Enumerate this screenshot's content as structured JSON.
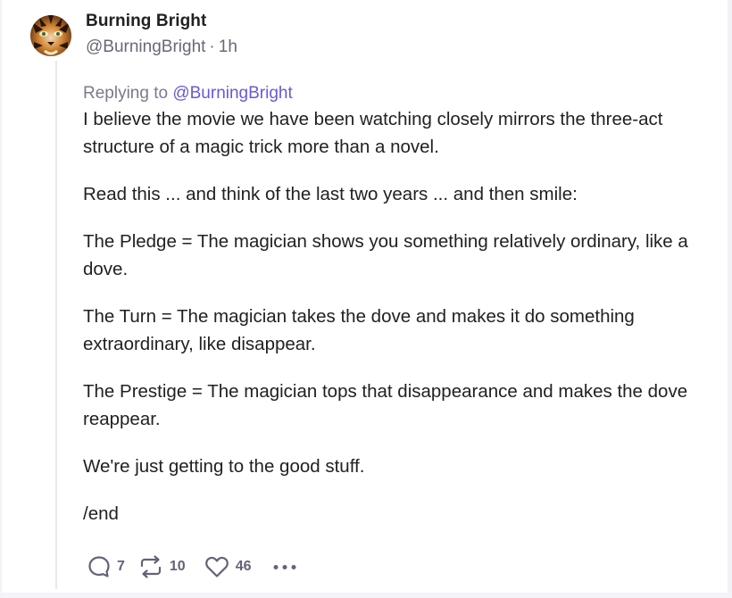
{
  "post": {
    "author": {
      "display_name": "Burning Bright",
      "handle": "@BurningBright",
      "timestamp": "1h",
      "separator": "·"
    },
    "reply": {
      "prefix": "Replying to",
      "handle": "@BurningBright"
    },
    "paragraphs": [
      "I believe the movie we have been watching closely mirrors the three-act structure of a magic trick more than a novel.",
      "Read this ... and think of the last two years ... and then smile:",
      "The Pledge = The magician shows you something relatively ordinary, like a dove.",
      "The Turn = The magician takes the dove and makes it do something extraordinary, like disappear.",
      "The Prestige = The magician tops that disappearance and makes the dove reappear.",
      "We're just getting to the good stuff.",
      "/end"
    ],
    "actions": {
      "replies": "7",
      "recasts": "10",
      "likes": "46"
    }
  },
  "icons": {
    "reply": "speech-bubble-icon",
    "recast": "recast-arrows-icon",
    "like": "heart-icon",
    "more": "more-dots-icon"
  },
  "colors": {
    "accent": "#6b57d6",
    "text": "#212121",
    "muted": "#686878"
  }
}
